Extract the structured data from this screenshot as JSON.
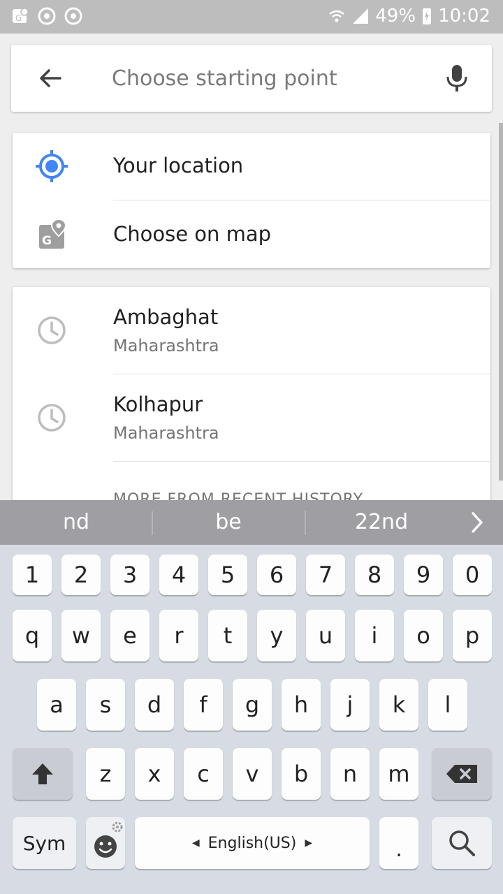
{
  "status_bar": {
    "battery": "49%",
    "time": "10:02",
    "notification_icons": [
      "maps-icon",
      "chrome-icon",
      "chrome-icon"
    ]
  },
  "search": {
    "placeholder": "Choose starting point"
  },
  "options": [
    {
      "label": "Your location",
      "icon": "my-location-icon",
      "accent": "#4285f4"
    },
    {
      "label": "Choose on map",
      "icon": "map-pin-icon"
    }
  ],
  "history": {
    "items": [
      {
        "title": "Ambaghat",
        "subtitle": "Maharashtra",
        "icon": "clock-icon"
      },
      {
        "title": "Kolhapur",
        "subtitle": "Maharashtra",
        "icon": "clock-icon"
      }
    ],
    "more_label": "MORE FROM RECENT HISTORY"
  },
  "keyboard": {
    "suggestions": [
      "nd",
      "be",
      "22nd"
    ],
    "number_row": [
      "1",
      "2",
      "3",
      "4",
      "5",
      "6",
      "7",
      "8",
      "9",
      "0"
    ],
    "row1": [
      "q",
      "w",
      "e",
      "r",
      "t",
      "y",
      "u",
      "i",
      "o",
      "p"
    ],
    "row2": [
      "a",
      "s",
      "d",
      "f",
      "g",
      "h",
      "j",
      "k",
      "l"
    ],
    "row3": [
      "z",
      "x",
      "c",
      "v",
      "b",
      "n",
      "m"
    ],
    "sym_label": "Sym",
    "language_label": "English(US)",
    "period_label": "."
  }
}
